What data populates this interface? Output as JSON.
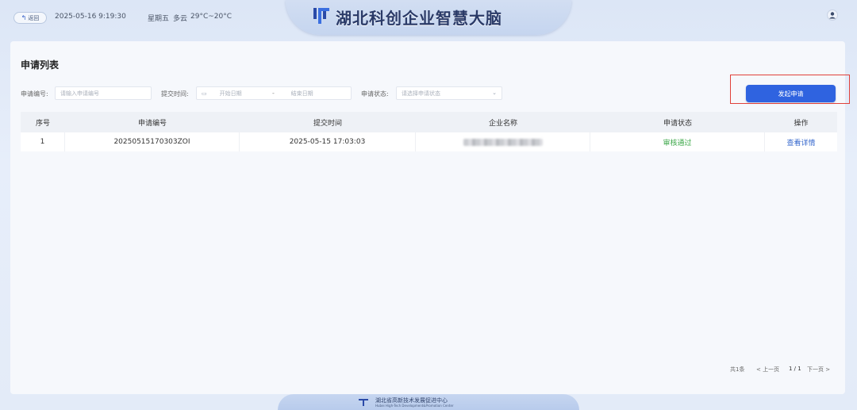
{
  "header": {
    "back_label": "返回",
    "date": "2025-05-16  9:19:30",
    "weekday": "星期五",
    "weather": "多云",
    "temp": "29°C~20°C",
    "app_title": "湖北科创企业智慧大脑"
  },
  "page": {
    "title": "申请列表",
    "apply_button": "发起申请"
  },
  "filters": {
    "app_no_label": "申请编号:",
    "app_no_placeholder": "请输入申请编号",
    "submit_time_label": "提交时间:",
    "start_placeholder": "开始日期",
    "separator": "-",
    "end_placeholder": "结束日期",
    "status_label": "申请状态:",
    "status_placeholder": "请选择申请状态"
  },
  "table": {
    "columns": [
      "序号",
      "申请编号",
      "提交时间",
      "企业名称",
      "申请状态",
      "操作"
    ],
    "rows": [
      {
        "index": "1",
        "app_no": "20250515170303ZOI",
        "submit_time": "2025-05-15 17:03:03",
        "status": "审核通过",
        "action": "查看详情"
      }
    ]
  },
  "pagination": {
    "total": "共1条",
    "prev": "< 上一页",
    "current": "1 / 1",
    "next": "下一页 >"
  },
  "footer": {
    "org_cn": "湖北省高新技术发展促进中心",
    "org_en": "Hubei High-Tech Development&Promotion Center"
  },
  "colors": {
    "accent": "#2f63e0",
    "status_ok": "#3ea84a",
    "link": "#3366cc",
    "highlight": "#e0413a"
  }
}
